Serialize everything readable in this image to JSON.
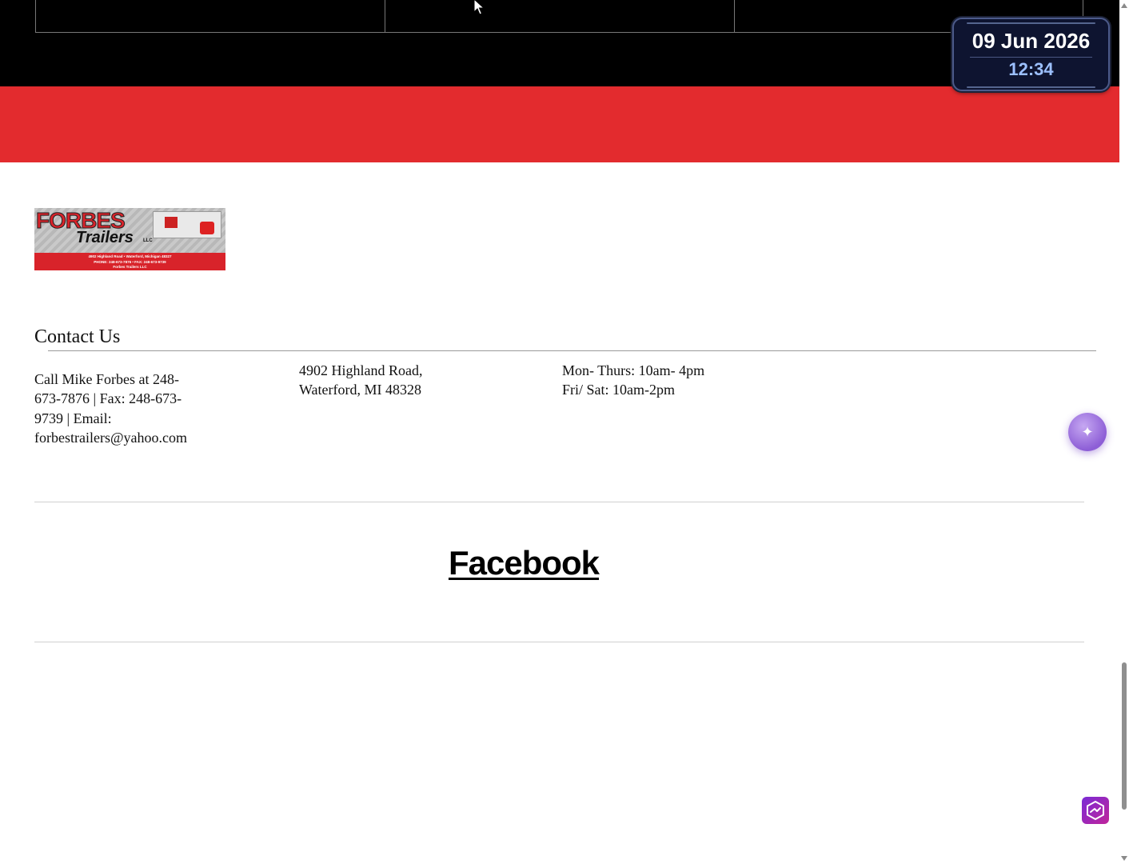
{
  "footer": {
    "logo": {
      "brand_top": "FORBES",
      "brand_bottom": "Trailers",
      "suffix": "LLC",
      "address_line": "4902 Highland Road  •  Waterford, Michigan 48327",
      "phone_line": "PHONE: 248-673-7876  •  FAX: 248-673-9739",
      "social_line": "Forbes Trailers LLC"
    },
    "contact_title": "Contact Us",
    "contact_info": {
      "line1": "Call Mike Forbes at 248-",
      "line2": "673-7876 | Fax: 248-673-",
      "line3": "9739 | Email:",
      "line4": "forbestrailers@yahoo.com"
    },
    "address": {
      "line1": "4902 Highland Road,",
      "line2": "Waterford, MI 48328"
    },
    "hours": {
      "line1": "Mon- Thurs:  10am- 4pm",
      "line2": "Fri/ Sat: 10am-2pm"
    },
    "facebook_link": "Facebook"
  },
  "clock_widget": {
    "date": "09 Jun 2026",
    "time": "12:34"
  },
  "colors": {
    "header_band": "#000000",
    "accent_band": "#e32b2e",
    "clock_bg": "#0e1430",
    "clock_time": "#9cc0ff",
    "assistant_button": "#8d5ed6"
  },
  "icons": {
    "assistant": "sparkle-icon",
    "extension": "extension-logo-icon",
    "cursor": "mouse-cursor-icon"
  }
}
